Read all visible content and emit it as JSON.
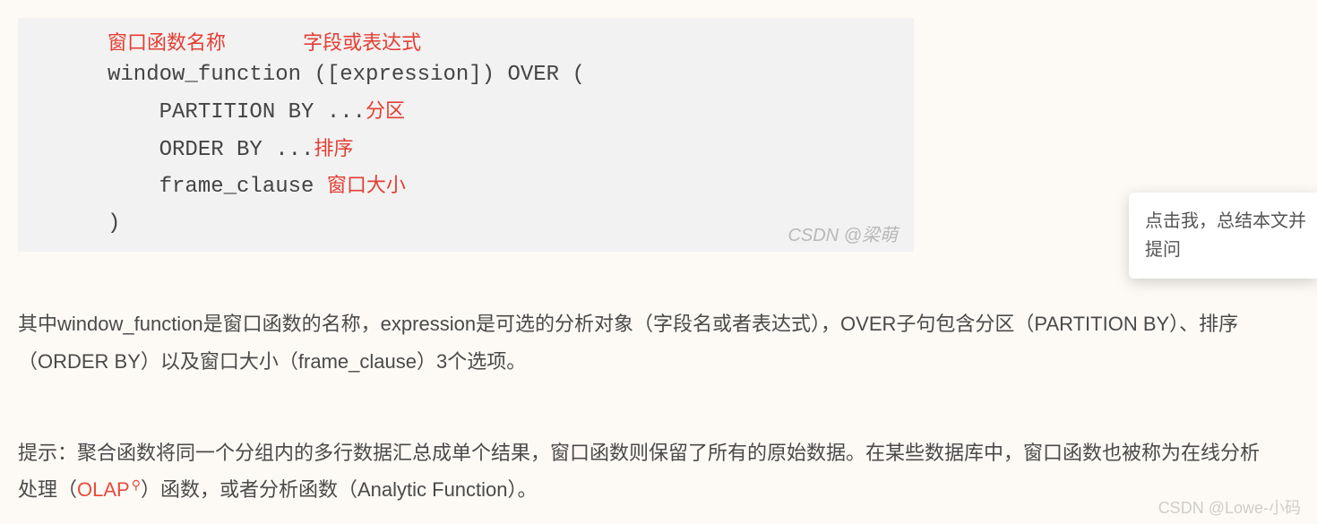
{
  "code": {
    "annotation_top": {
      "ann1": "窗口函数名称",
      "ann2": "字段或表达式"
    },
    "line1": "window_function ([expression]) OVER (",
    "line2_prefix": "    PARTITION BY ...",
    "line2_ann": "分区",
    "line3_prefix": "    ORDER BY ...",
    "line3_ann": "排序",
    "line4_prefix": "    frame_clause ",
    "line4_ann": "窗口大小",
    "line5": ")",
    "watermark": "CSDN @梁萌"
  },
  "paragraph1": "其中window_function是窗口函数的名称，expression是可选的分析对象（字段名或者表达式），OVER子句包含分区（PARTITION BY）、排序（ORDER BY）以及窗口大小（frame_clause）3个选项。",
  "paragraph2_prefix": "提示：聚合函数将同一个分组内的多行数据汇总成单个结果，窗口函数则保留了所有的原始数据。在某些数据库中，窗口函数也被称为在线分析处理（",
  "olap_text": "OLAP",
  "paragraph2_suffix": "）函数，或者分析函数（Analytic Function）。",
  "floating_tip": "点击我，总结本文并提问",
  "bottom_watermark": "CSDN @Lowe-小码"
}
